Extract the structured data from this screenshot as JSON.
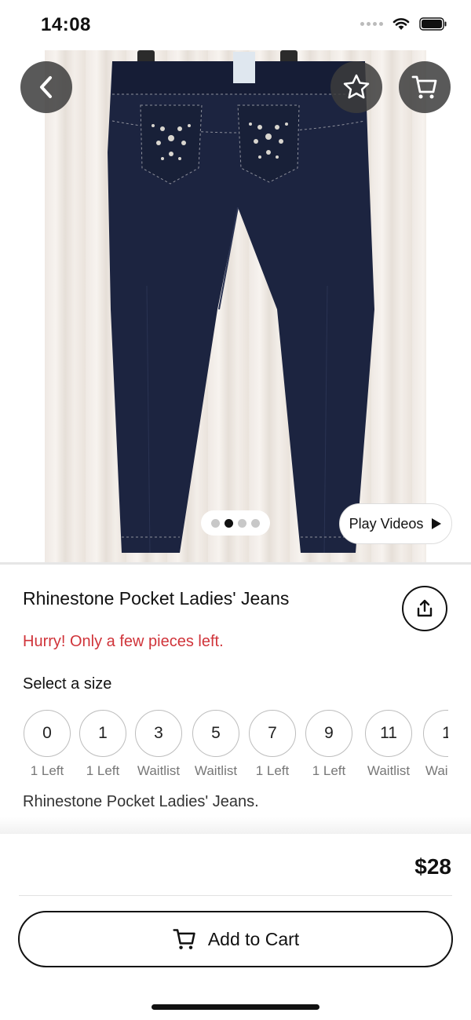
{
  "status_bar": {
    "time": "14:08"
  },
  "hero": {
    "image_description_icon": "product-photo",
    "pager": {
      "count": 4,
      "active_index": 1
    },
    "play_videos_label": "Play Videos"
  },
  "product": {
    "title": "Rhinestone Pocket Ladies' Jeans",
    "stock_warning": "Hurry! Only a few pieces left.",
    "select_size_label": "Select a size",
    "sizes": [
      {
        "size": "0",
        "note": "1 Left"
      },
      {
        "size": "1",
        "note": "1 Left"
      },
      {
        "size": "3",
        "note": "Waitlist"
      },
      {
        "size": "5",
        "note": "Waitlist"
      },
      {
        "size": "7",
        "note": "1 Left"
      },
      {
        "size": "9",
        "note": "1 Left"
      },
      {
        "size": "11",
        "note": "Waitlist"
      },
      {
        "size": "1",
        "note": "Waitlist"
      }
    ],
    "description": "Rhinestone Pocket Ladies' Jeans.",
    "price": "$28"
  },
  "actions": {
    "add_to_cart_label": "Add to Cart"
  },
  "colors": {
    "accent_red": "#d0343a",
    "overlay_button": "#3c3c3c",
    "denim": "#1c2440"
  }
}
